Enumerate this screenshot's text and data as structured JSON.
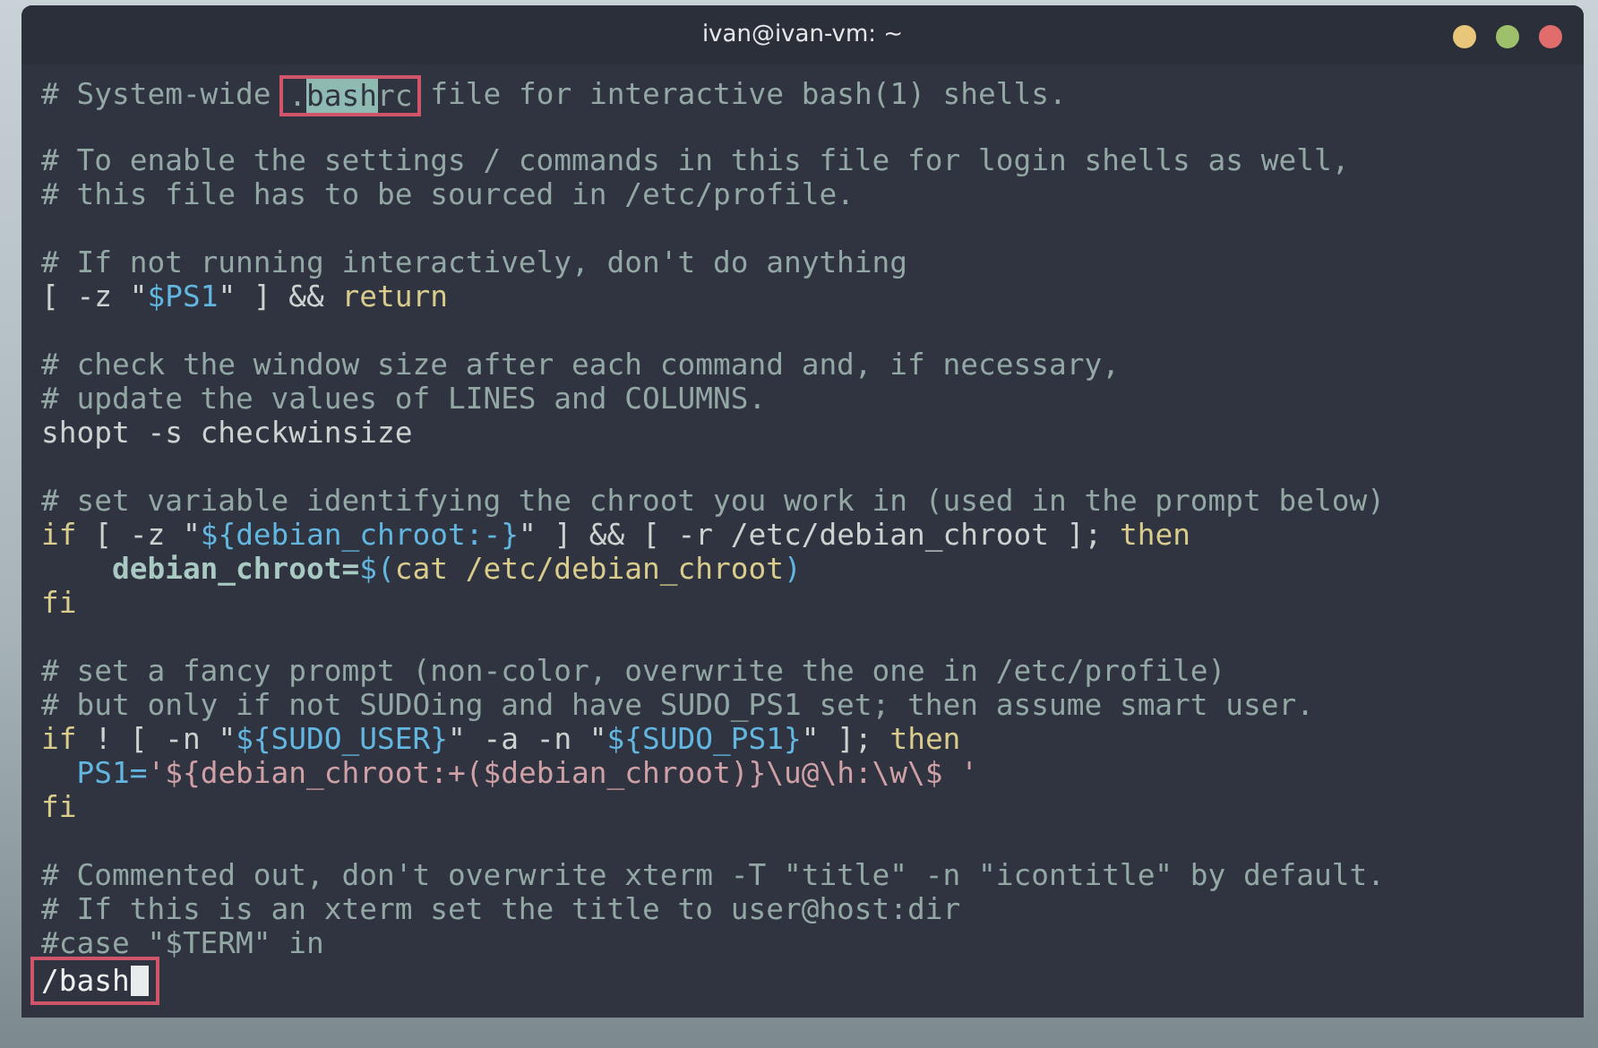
{
  "window": {
    "title": "ivan@ivan-vm: ~"
  },
  "lines": [
    {
      "kind": "code",
      "items": [
        {
          "text": "# System-wide ",
          "kind": "comment"
        },
        {
          "boxed": true,
          "segments": [
            {
              "text": ".",
              "kind": "comment"
            },
            {
              "text": "bash",
              "kind": "match"
            },
            {
              "text": "rc",
              "kind": "comment"
            }
          ]
        },
        {
          "text": " file for interactive bash(1) shells.",
          "kind": "comment"
        }
      ]
    },
    {
      "kind": "blank"
    },
    {
      "kind": "code",
      "items": [
        {
          "text": "# To enable the settings / commands in this file for login shells as well,",
          "kind": "comment"
        }
      ]
    },
    {
      "kind": "code",
      "items": [
        {
          "text": "# this file has to be sourced in /etc/profile.",
          "kind": "comment"
        }
      ]
    },
    {
      "kind": "blank"
    },
    {
      "kind": "code",
      "items": [
        {
          "text": "# If not running interactively, don't do anything",
          "kind": "comment"
        }
      ]
    },
    {
      "kind": "code",
      "items": [
        {
          "text": "[ -z \"",
          "kind": "plain"
        },
        {
          "text": "$PS1",
          "kind": "var"
        },
        {
          "text": "\" ] && ",
          "kind": "plain"
        },
        {
          "text": "return",
          "kind": "keyword"
        }
      ]
    },
    {
      "kind": "blank"
    },
    {
      "kind": "code",
      "items": [
        {
          "text": "# check the window size after each command and, if necessary,",
          "kind": "comment"
        }
      ]
    },
    {
      "kind": "code",
      "items": [
        {
          "text": "# update the values of LINES and COLUMNS.",
          "kind": "comment"
        }
      ]
    },
    {
      "kind": "code",
      "items": [
        {
          "text": "shopt -s checkwinsize",
          "kind": "plain"
        }
      ]
    },
    {
      "kind": "blank"
    },
    {
      "kind": "code",
      "items": [
        {
          "text": "# set variable identifying the chroot you work in (used in the prompt below)",
          "kind": "comment"
        }
      ]
    },
    {
      "kind": "code",
      "items": [
        {
          "text": "if",
          "kind": "keyword"
        },
        {
          "text": " [ -z \"",
          "kind": "plain"
        },
        {
          "text": "${debian_chroot:-}",
          "kind": "var"
        },
        {
          "text": "\" ] && [ -r /etc/debian_chroot ]; ",
          "kind": "plain"
        },
        {
          "text": "then",
          "kind": "keyword"
        }
      ]
    },
    {
      "kind": "code",
      "items": [
        {
          "text": "    debian_chroot=",
          "kind": "bold"
        },
        {
          "text": "$(",
          "kind": "var"
        },
        {
          "text": "cat /etc/debian_chroot",
          "kind": "keyword"
        },
        {
          "text": ")",
          "kind": "var"
        }
      ]
    },
    {
      "kind": "code",
      "items": [
        {
          "text": "fi",
          "kind": "keyword"
        }
      ]
    },
    {
      "kind": "blank"
    },
    {
      "kind": "code",
      "items": [
        {
          "text": "# set a fancy prompt (non-color, overwrite the one in /etc/profile)",
          "kind": "comment"
        }
      ]
    },
    {
      "kind": "code",
      "items": [
        {
          "text": "# but only if not SUDOing and have SUDO_PS1 set; then assume smart user.",
          "kind": "comment"
        }
      ]
    },
    {
      "kind": "code",
      "items": [
        {
          "text": "if",
          "kind": "keyword"
        },
        {
          "text": " ! [ -n \"",
          "kind": "plain"
        },
        {
          "text": "${SUDO_USER}",
          "kind": "var"
        },
        {
          "text": "\" -a -n \"",
          "kind": "plain"
        },
        {
          "text": "${SUDO_PS1}",
          "kind": "var"
        },
        {
          "text": "\" ]; ",
          "kind": "plain"
        },
        {
          "text": "then",
          "kind": "keyword"
        }
      ]
    },
    {
      "kind": "code",
      "items": [
        {
          "text": "  PS1=",
          "kind": "var"
        },
        {
          "text": "'${debian_chroot:+($debian_chroot)}\\u@\\h:\\w\\$ '",
          "kind": "string"
        }
      ]
    },
    {
      "kind": "code",
      "items": [
        {
          "text": "fi",
          "kind": "keyword"
        }
      ]
    },
    {
      "kind": "blank"
    },
    {
      "kind": "code",
      "items": [
        {
          "text": "# Commented out, don't overwrite xterm -T \"title\" -n \"icontitle\" by default.",
          "kind": "comment"
        }
      ]
    },
    {
      "kind": "code",
      "items": [
        {
          "text": "# If this is an xterm set the title to user@host:dir",
          "kind": "comment"
        }
      ]
    },
    {
      "kind": "code",
      "items": [
        {
          "text": "#case \"$TERM\" in",
          "kind": "comment"
        }
      ]
    }
  ],
  "search_prompt": {
    "text": "/bash",
    "boxed": true
  }
}
